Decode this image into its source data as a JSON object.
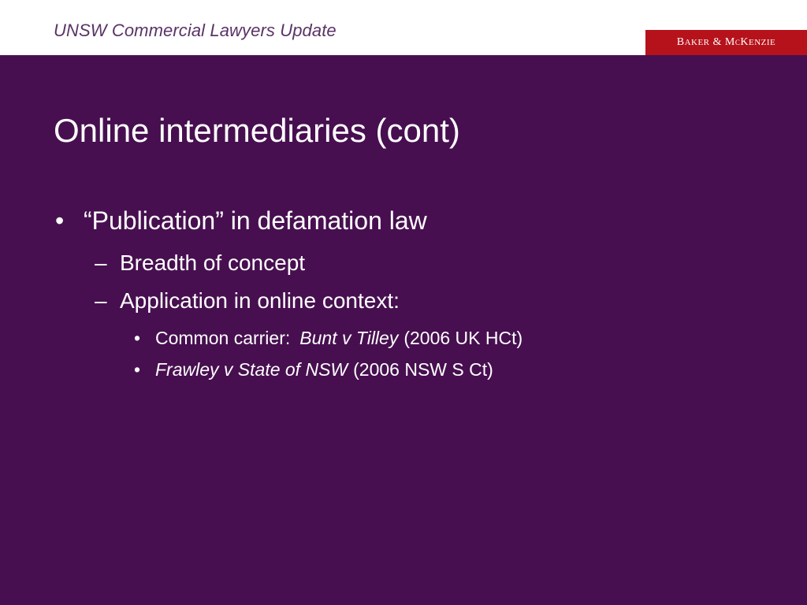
{
  "header": {
    "title": "UNSW Commercial Lawyers Update",
    "logo": {
      "b": "B",
      "aker": "AKER",
      "amp": " & M",
      "c": "C",
      "k": "K",
      "enzie": "ENZIE"
    }
  },
  "slide": {
    "title": "Online intermediaries (cont)",
    "bullets": [
      {
        "marker": "•",
        "text": "“Publication” in defamation law",
        "children": [
          {
            "marker": "–",
            "text": "Breadth of concept"
          },
          {
            "marker": "–",
            "text": "Application in online context:",
            "children": [
              {
                "marker": "•",
                "prefix": "Common carrier:",
                "case": "Bunt v Tilley",
                "suffix": "(2006 UK HCt)"
              },
              {
                "marker": "•",
                "case": "Frawley v State of NSW",
                "suffix": "(2006 NSW S Ct)"
              }
            ]
          }
        ]
      }
    ]
  },
  "colors": {
    "background": "#470f50",
    "header_bg": "#ffffff",
    "header_text": "#5a3366",
    "logo_bg": "#b5121b",
    "text": "#ffffff"
  }
}
